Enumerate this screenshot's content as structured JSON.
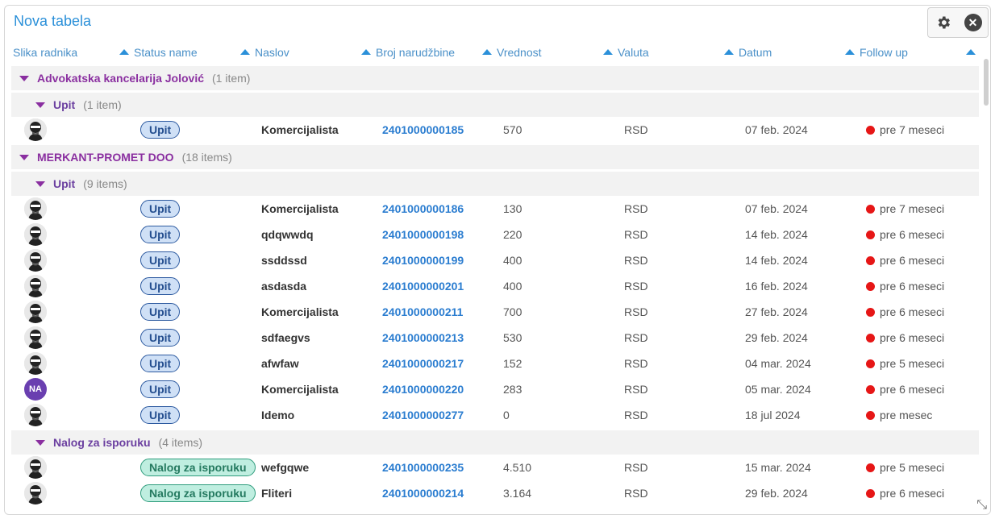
{
  "title": "Nova tabela",
  "toolbar": {
    "settings_icon": "gear-icon",
    "close_icon": "close-icon",
    "close_glyph": "✕"
  },
  "columns": [
    {
      "label": "Slika radnika"
    },
    {
      "label": "Status name"
    },
    {
      "label": "Naslov"
    },
    {
      "label": "Broj narudžbine"
    },
    {
      "label": "Vrednost"
    },
    {
      "label": "Valuta"
    },
    {
      "label": "Datum"
    },
    {
      "label": "Follow up"
    }
  ],
  "groups": [
    {
      "name": "Advokatska kancelarija Jolović",
      "count": "(1 item)"
    },
    {
      "name": "Upit",
      "count": "(1 item)"
    },
    {
      "name": "MERKANT-PROMET DOO",
      "count": "(18 items)"
    },
    {
      "name": "Upit",
      "count": "(9 items)"
    },
    {
      "name": "Nalog za isporuku",
      "count": "(4 items)"
    }
  ],
  "rows": [
    {
      "avatar": "photo",
      "status": "Upit",
      "naslov": "Komercijalista",
      "broj": "2401000000185",
      "vrednost": "570",
      "valuta": "RSD",
      "datum": "07 feb. 2024",
      "follow": "pre 7 meseci"
    },
    {
      "avatar": "photo",
      "status": "Upit",
      "naslov": "Komercijalista",
      "broj": "2401000000186",
      "vrednost": "130",
      "valuta": "RSD",
      "datum": "07 feb. 2024",
      "follow": "pre 7 meseci"
    },
    {
      "avatar": "photo",
      "status": "Upit",
      "naslov": "qdqwwdq",
      "broj": "2401000000198",
      "vrednost": "220",
      "valuta": "RSD",
      "datum": "14 feb. 2024",
      "follow": "pre 6 meseci"
    },
    {
      "avatar": "photo",
      "status": "Upit",
      "naslov": "ssddssd",
      "broj": "2401000000199",
      "vrednost": "400",
      "valuta": "RSD",
      "datum": "14 feb. 2024",
      "follow": "pre 6 meseci"
    },
    {
      "avatar": "photo",
      "status": "Upit",
      "naslov": "asdasda",
      "broj": "2401000000201",
      "vrednost": "400",
      "valuta": "RSD",
      "datum": "16 feb. 2024",
      "follow": "pre 6 meseci"
    },
    {
      "avatar": "photo",
      "status": "Upit",
      "naslov": "Komercijalista",
      "broj": "2401000000211",
      "vrednost": "700",
      "valuta": "RSD",
      "datum": "27 feb. 2024",
      "follow": "pre 6 meseci"
    },
    {
      "avatar": "photo",
      "status": "Upit",
      "naslov": "sdfaegvs",
      "broj": "2401000000213",
      "vrednost": "530",
      "valuta": "RSD",
      "datum": "29 feb. 2024",
      "follow": "pre 6 meseci"
    },
    {
      "avatar": "photo",
      "status": "Upit",
      "naslov": "afwfaw",
      "broj": "2401000000217",
      "vrednost": "152",
      "valuta": "RSD",
      "datum": "04 mar. 2024",
      "follow": "pre 5 meseci"
    },
    {
      "avatar": "NA",
      "status": "Upit",
      "naslov": "Komercijalista",
      "broj": "2401000000220",
      "vrednost": "283",
      "valuta": "RSD",
      "datum": "05 mar. 2024",
      "follow": "pre 6 meseci"
    },
    {
      "avatar": "photo",
      "status": "Upit",
      "naslov": "Idemo",
      "broj": "2401000000277",
      "vrednost": "0",
      "valuta": "RSD",
      "datum": "18 jul 2024",
      "follow": "pre mesec"
    },
    {
      "avatar": "photo",
      "status": "Nalog za isporuku",
      "naslov": "wefgqwe",
      "broj": "2401000000235",
      "vrednost": "4.510",
      "valuta": "RSD",
      "datum": "15 mar. 2024",
      "follow": "pre 5 meseci"
    },
    {
      "avatar": "photo",
      "status": "Nalog za isporuku",
      "naslov": "Fliteri",
      "broj": "2401000000214",
      "vrednost": "3.164",
      "valuta": "RSD",
      "datum": "29 feb. 2024",
      "follow": "pre 6 meseci"
    }
  ],
  "colors": {
    "accent": "#2b90d9",
    "group": "#8a2fa0",
    "follow_dot": "#e61616"
  },
  "resize_glyph": "⤡"
}
